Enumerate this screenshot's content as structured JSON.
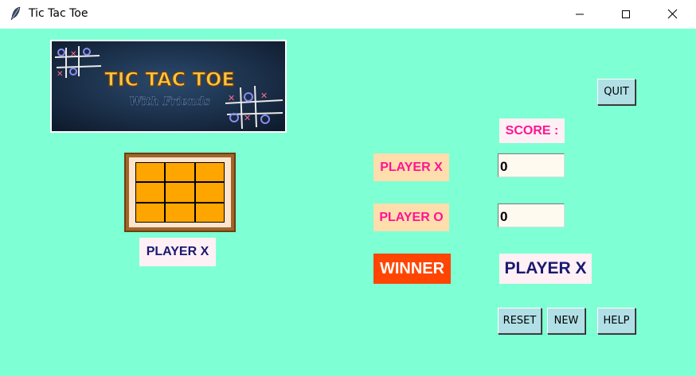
{
  "window": {
    "title": "Tic Tac Toe",
    "controls": {
      "minimize": "minimize-icon",
      "maximize": "maximize-icon",
      "close": "close-icon"
    }
  },
  "banner": {
    "title": "TIC TAC TOE",
    "subtitle": "With Friends"
  },
  "board": {
    "cells": [
      "",
      "",
      "",
      "",
      "",
      "",
      "",
      "",
      ""
    ],
    "cell_color": "#ffa500"
  },
  "current_turn": "PLAYER X",
  "buttons": {
    "quit": "QUIT",
    "reset": "RESET",
    "new": "NEW",
    "help": "HELP"
  },
  "score": {
    "title": "SCORE :",
    "player_x_label": "PLAYER X",
    "player_o_label": "PLAYER O",
    "player_x_score": "0",
    "player_o_score": "0"
  },
  "winner": {
    "label": "WINNER",
    "value": "PLAYER X"
  },
  "colors": {
    "background": "#7fffd4",
    "accent_pink": "#ff1493",
    "winner_bg": "#ff4500",
    "navy_text": "#191970",
    "button_bg": "#b0e0e6"
  }
}
